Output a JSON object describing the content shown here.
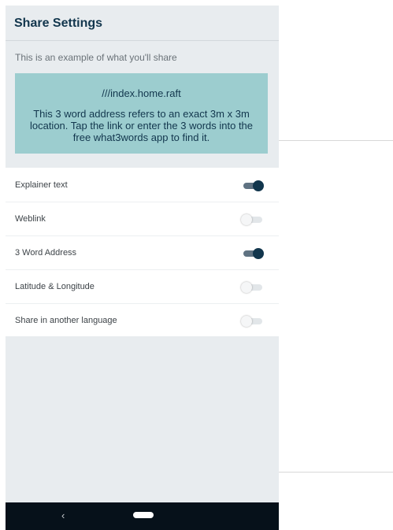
{
  "header": {
    "title": "Share Settings"
  },
  "preview": {
    "subtitle": "This is an example of what you'll share",
    "address": "///index.home.raft",
    "description": "This 3 word address refers to an exact 3m x 3m location. Tap the link or enter the 3 words into the free what3words app to find it.",
    "background_color": "#9ccdcf"
  },
  "settings": [
    {
      "label": "Explainer text",
      "enabled": true
    },
    {
      "label": "Weblink",
      "enabled": false
    },
    {
      "label": "3 Word Address",
      "enabled": true
    },
    {
      "label": "Latitude & Longitude",
      "enabled": false
    },
    {
      "label": "Share in another language",
      "enabled": false
    }
  ],
  "navbar": {
    "back_icon": "chevron-left-icon",
    "home_icon": "home-pill-icon"
  },
  "colors": {
    "accent": "#12364d",
    "toggle_on": "#12364d",
    "navbar": "#06111a"
  }
}
